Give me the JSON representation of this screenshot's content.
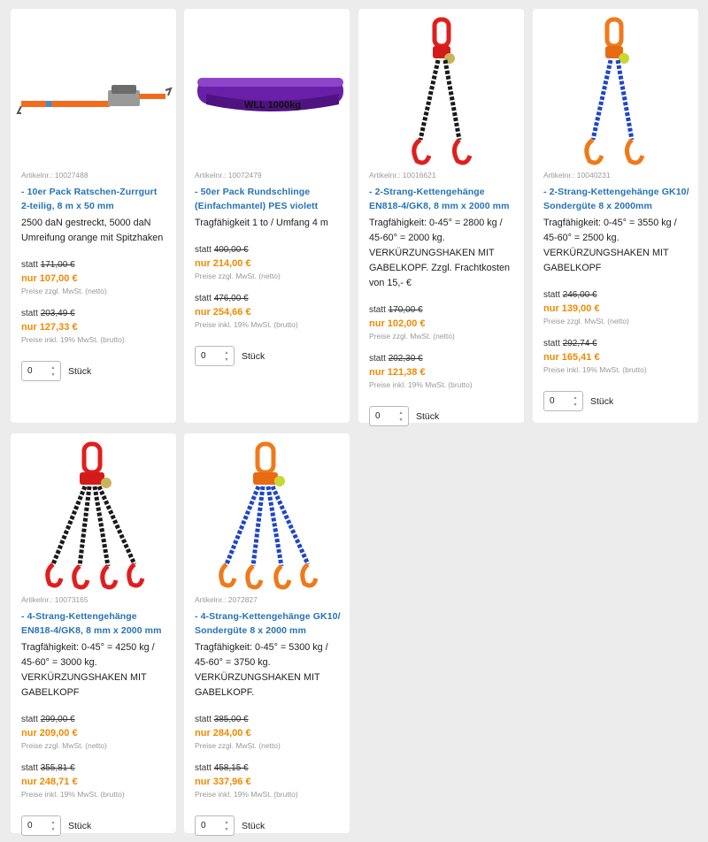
{
  "colors": {
    "accent_blue": "#2673b4",
    "price_orange": "#f08a00",
    "background": "#ececec"
  },
  "products": [
    {
      "image": "orange-ratchet-strap-image",
      "article": "Artikelnr.: 10027488",
      "title": "- 10er Pack Ratschen-Zurrgurt 2-teilig, 8 m x 50 mm",
      "description": "2500 daN gestreckt, 5000 daN Umreifung orange mit Spitzhaken",
      "net": {
        "statt": "statt",
        "old": "171,00 €",
        "now": "nur 107,00 €",
        "note": "Preise zzgl. MwSt. (netto)"
      },
      "gross": {
        "statt": "statt",
        "old": "203,49 €",
        "now": "nur 127,33 €",
        "note": "Preise inkl. 19% MwSt. (brutto)"
      },
      "quantity": "0",
      "unit": "Stück"
    },
    {
      "image": "purple-round-sling-image",
      "image_text": "WLL 1000kg",
      "article": "Artikelnr.: 10072479",
      "title": "- 50er Pack Rundschlinge (Einfachmantel) PES violett",
      "description": "Tragfähigkeit 1 to / Umfang 4 m",
      "net": {
        "statt": "statt",
        "old": "400,00 €",
        "now": "nur 214,00 €",
        "note": "Preise zzgl. MwSt. (netto)"
      },
      "gross": {
        "statt": "statt",
        "old": "476,00 €",
        "now": "nur 254,66 €",
        "note": "Preise inkl. 19% MwSt. (brutto)"
      },
      "quantity": "0",
      "unit": "Stück"
    },
    {
      "image": "2-leg-chain-sling-black-red-image",
      "article": "Artikelnr.: 10016621",
      "title": "- 2-Strang-Kettengehänge EN818-4/GK8, 8 mm x 2000 mm",
      "description": "Tragfähigkeit: 0-45° = 2800 kg / 45-60° = 2000 kg. VERKÜRZUNGSHAKEN MIT GABELKOPF. Zzgl. Frachtkosten von 15,- €",
      "net": {
        "statt": "statt",
        "old": "170,00 €",
        "now": "nur 102,00 €",
        "note": "Preise zzgl. MwSt. (netto)"
      },
      "gross": {
        "statt": "statt",
        "old": "202,30 €",
        "now": "nur 121,38 €",
        "note": "Preise inkl. 19% MwSt. (brutto)"
      },
      "quantity": "0",
      "unit": "Stück"
    },
    {
      "image": "2-leg-chain-sling-blue-orange-image",
      "article": "Artikelnr.: 10040231",
      "title": "- 2-Strang-Kettengehänge GK10/ Sondergüte 8 x 2000mm",
      "description": "Tragfähigkeit: 0-45° = 3550 kg / 45-60° = 2500 kg. VERKÜRZUNGSHAKEN MIT GABELKOPF",
      "net": {
        "statt": "statt",
        "old": "246,00 €",
        "now": "nur 139,00 €",
        "note": "Preise zzgl. MwSt. (netto)"
      },
      "gross": {
        "statt": "statt",
        "old": "292,74 €",
        "now": "nur 165,41 €",
        "note": "Preise inkl. 19% MwSt. (brutto)"
      },
      "quantity": "0",
      "unit": "Stück"
    },
    {
      "image": "4-leg-chain-sling-black-red-image",
      "article": "Artikelnr.: 10073165",
      "title": "- 4-Strang-Kettengehänge EN818-4/GK8, 8 mm x 2000 mm",
      "description": "Tragfähigkeit: 0-45° = 4250 kg / 45-60° = 3000 kg. VERKÜRZUNGSHAKEN MIT GABELKOPF",
      "net": {
        "statt": "statt",
        "old": "299,00 €",
        "now": "nur 209,00 €",
        "note": "Preise zzgl. MwSt. (netto)"
      },
      "gross": {
        "statt": "statt",
        "old": "355,81 €",
        "now": "nur 248,71 €",
        "note": "Preise inkl. 19% MwSt. (brutto)"
      },
      "quantity": "0",
      "unit": "Stück"
    },
    {
      "image": "4-leg-chain-sling-blue-orange-image",
      "article": "Artikelnr.: 2072827",
      "title": "- 4-Strang-Kettengehänge GK10/ Sondergüte 8 x 2000 mm",
      "description": "Tragfähigkeit: 0-45° = 5300 kg / 45-60° = 3750 kg. VERKÜRZUNGSHAKEN MIT GABELKOPF.",
      "net": {
        "statt": "statt",
        "old": "385,00 €",
        "now": "nur 284,00 €",
        "note": "Preise zzgl. MwSt. (netto)"
      },
      "gross": {
        "statt": "statt",
        "old": "458,15 €",
        "now": "nur 337,96 €",
        "note": "Preise inkl. 19% MwSt. (brutto)"
      },
      "quantity": "0",
      "unit": "Stück"
    }
  ]
}
